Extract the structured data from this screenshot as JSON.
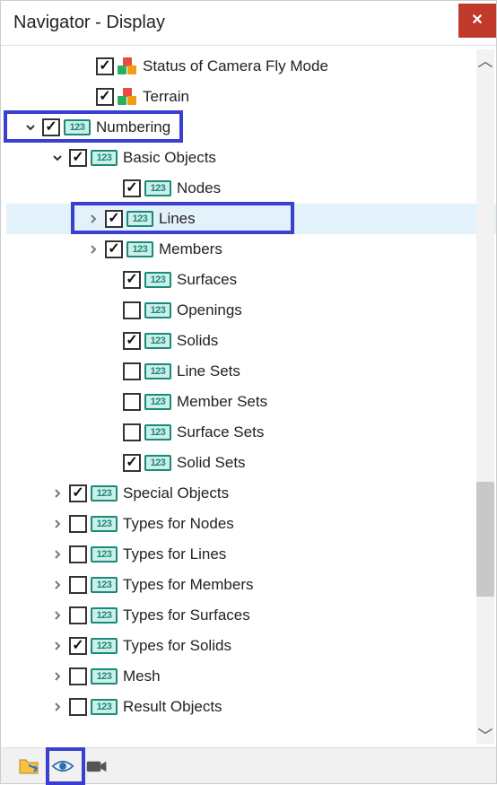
{
  "window": {
    "title": "Navigator - Display",
    "close_symbol": "✕"
  },
  "icon_text": "123",
  "tree": {
    "top_items": [
      {
        "label": "Status of Camera Fly Mode",
        "checked": true,
        "indent": 78,
        "expander": "",
        "icon": "cubes"
      },
      {
        "label": "Terrain",
        "checked": true,
        "indent": 78,
        "expander": "",
        "icon": "cubes"
      }
    ],
    "numbering": {
      "label": "Numbering",
      "checked": true,
      "indent": 18,
      "expander": "down"
    },
    "basic_objects": {
      "label": "Basic Objects",
      "checked": true,
      "indent": 48,
      "expander": "down"
    },
    "basic_children": [
      {
        "label": "Nodes",
        "checked": true,
        "indent": 108,
        "expander": ""
      },
      {
        "label": "Lines",
        "checked": true,
        "indent": 88,
        "expander": "right",
        "selected": true
      },
      {
        "label": "Members",
        "checked": true,
        "indent": 88,
        "expander": "right"
      },
      {
        "label": "Surfaces",
        "checked": true,
        "indent": 108,
        "expander": ""
      },
      {
        "label": "Openings",
        "checked": false,
        "indent": 108,
        "expander": ""
      },
      {
        "label": "Solids",
        "checked": true,
        "indent": 108,
        "expander": ""
      },
      {
        "label": "Line Sets",
        "checked": false,
        "indent": 108,
        "expander": ""
      },
      {
        "label": "Member Sets",
        "checked": false,
        "indent": 108,
        "expander": ""
      },
      {
        "label": "Surface Sets",
        "checked": false,
        "indent": 108,
        "expander": ""
      },
      {
        "label": "Solid Sets",
        "checked": true,
        "indent": 108,
        "expander": ""
      }
    ],
    "siblings": [
      {
        "label": "Special Objects",
        "checked": true,
        "indent": 48,
        "expander": "right"
      },
      {
        "label": "Types for Nodes",
        "checked": false,
        "indent": 48,
        "expander": "right"
      },
      {
        "label": "Types for Lines",
        "checked": false,
        "indent": 48,
        "expander": "right"
      },
      {
        "label": "Types for Members",
        "checked": false,
        "indent": 48,
        "expander": "right"
      },
      {
        "label": "Types for Surfaces",
        "checked": false,
        "indent": 48,
        "expander": "right"
      },
      {
        "label": "Types for Solids",
        "checked": true,
        "indent": 48,
        "expander": "right"
      },
      {
        "label": "Mesh",
        "checked": false,
        "indent": 48,
        "expander": "right"
      },
      {
        "label": "Result Objects",
        "checked": false,
        "indent": 48,
        "expander": "right"
      }
    ]
  }
}
